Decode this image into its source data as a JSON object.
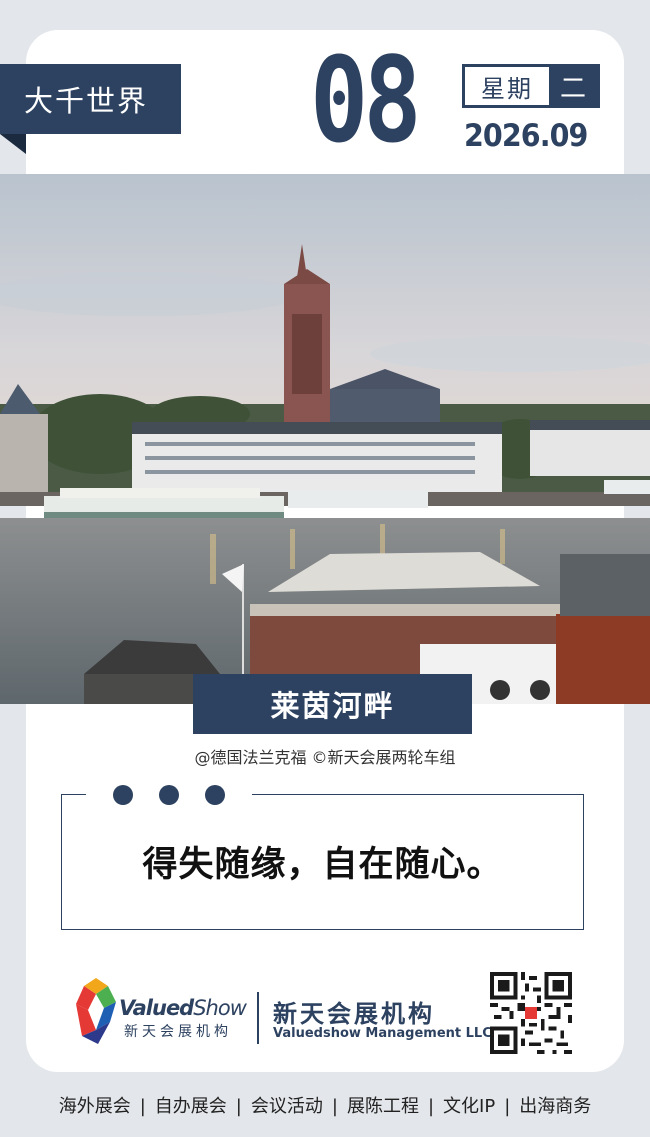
{
  "header": {
    "tag": "大千世界",
    "day": "08",
    "weekday_label": "星期",
    "weekday_value": "二",
    "year_month": "2026.09"
  },
  "photo": {
    "caption": "莱茵河畔",
    "credit": "@德国法兰克福 ©新天会展两轮车组"
  },
  "quote": {
    "text": "得失随缘，自在随心。"
  },
  "brand": {
    "logo_en_bold": "Valued",
    "logo_en_light": "Show",
    "logo_cn": "新天会展机构",
    "org_cn": "新天会展机构",
    "org_en": "Valuedshow Management LLC."
  },
  "footer": {
    "items": [
      "海外展会",
      "自办展会",
      "会议活动",
      "展陈工程",
      "文化IP",
      "出海商务"
    ],
    "separator": "|"
  },
  "colors": {
    "primary": "#2d4260",
    "background": "#e3e6ea"
  }
}
